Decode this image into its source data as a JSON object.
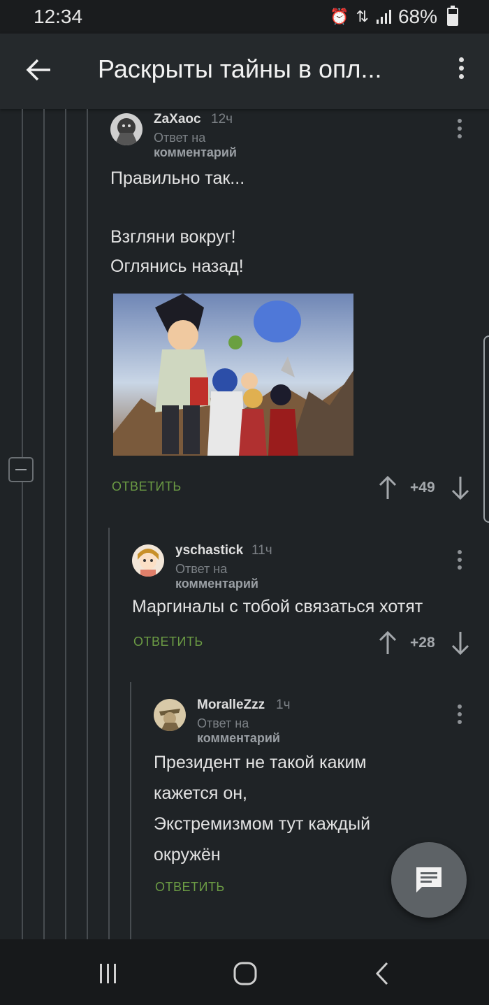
{
  "status_bar": {
    "time": "12:34",
    "battery": "68%"
  },
  "app_bar": {
    "title": "Раскрыты тайны в опл..."
  },
  "comments": [
    {
      "author": "ZaXaoc",
      "time": "12ч",
      "reply_prefix": "Ответ на",
      "reply_target": "комментарий",
      "text": "Правильно так...\n\nВзгляни вокруг!\nОглянись назад!",
      "reply_label": "ОТВЕТИТЬ",
      "score": "+49"
    },
    {
      "author": "yschastick",
      "time": "11ч",
      "reply_prefix": "Ответ на",
      "reply_target": "комментарий",
      "text": "Маргиналы с тобой связаться хотят",
      "reply_label": "ОТВЕТИТЬ",
      "score": "+28"
    },
    {
      "author": "MoralleZzz",
      "time": "1ч",
      "reply_prefix": "Ответ на",
      "reply_target": "комментарий",
      "text": "Президент не такой каким\nкажется он,\nЭкстремизмом тут каждый\nокружён",
      "reply_label": "ОТВЕТИТЬ"
    }
  ],
  "colors": {
    "background": "#1f2326",
    "reply_green": "#6b9b44",
    "thread_line": "#474c50"
  },
  "icons": [
    "back-arrow-icon",
    "more-vert-icon",
    "upvote-icon",
    "downvote-icon",
    "comment-icon",
    "recents-icon",
    "home-icon",
    "back-icon"
  ]
}
